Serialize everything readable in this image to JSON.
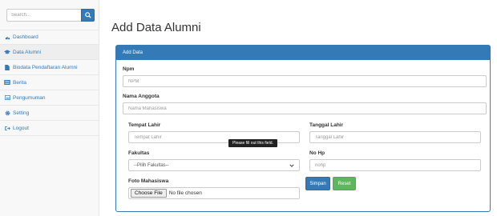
{
  "sidebar": {
    "search": {
      "placeholder": "Search..."
    },
    "items": [
      {
        "label": "Dashboard",
        "icon": "dashboard-icon"
      },
      {
        "label": "Data Alumni",
        "icon": "graduation-cap-icon",
        "active": true
      },
      {
        "label": "Biodata Pendaftaran Alumni",
        "icon": "file-icon"
      },
      {
        "label": "Berita",
        "icon": "newspaper-icon"
      },
      {
        "label": "Pengumuman",
        "icon": "image-icon"
      },
      {
        "label": "Setting",
        "icon": "gear-icon"
      },
      {
        "label": "Logout",
        "icon": "sign-out-icon"
      }
    ]
  },
  "main": {
    "title": "Add Data Alumni",
    "panel_heading": "Add Data",
    "form": {
      "npm": {
        "label": "Npm",
        "placeholder": "NPM"
      },
      "nama": {
        "label": "Nama Anggota",
        "placeholder": "Nama Mahasiswa"
      },
      "tempat_lahir": {
        "label": "Tempat Lahir",
        "placeholder": "Tempat Lahir"
      },
      "tanggal_lahir": {
        "label": "Tanggal Lahir",
        "placeholder": "Tanggal Lahir"
      },
      "fakultas": {
        "label": "Fakultas",
        "selected": "--Pilih Fakultas--"
      },
      "no_hp": {
        "label": "No Hp",
        "placeholder": "nohp"
      },
      "foto": {
        "label": "Foto Mahasiswa",
        "button": "Choose File",
        "status": "No file chosen"
      },
      "tooltip": "Please fill out this field.",
      "submit_label": "Simpan",
      "reset_label": "Reset"
    }
  },
  "colors": {
    "primary": "#337ab7",
    "success": "#5cb85c",
    "link": "#337ab7"
  }
}
